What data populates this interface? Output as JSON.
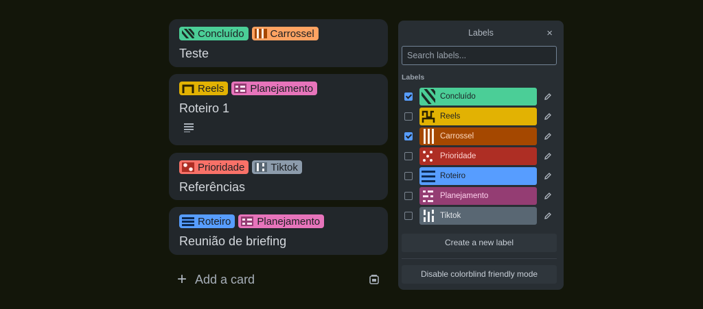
{
  "colors": {
    "background": "#13160a",
    "card": "#22272b",
    "popover": "#282e33",
    "green": "#4bce97",
    "orange": "#fea362",
    "yellow": "#e2b203",
    "red": "#f87168",
    "purple": "#e774bb",
    "gray": "#8c9bab",
    "blue": "#579dff"
  },
  "cards": [
    {
      "title": "Teste",
      "labels": [
        "Concluído",
        "Carrossel"
      ]
    },
    {
      "title": "Roteiro 1",
      "labels": [
        "Reels",
        "Planejamento"
      ],
      "has_description": true
    },
    {
      "title": "Referências",
      "labels": [
        "Prioridade",
        "Tiktok"
      ]
    },
    {
      "title": "Reunião de briefing",
      "labels": [
        "Roteiro",
        "Planejamento"
      ]
    }
  ],
  "add_card": {
    "label": "Add a card"
  },
  "popover": {
    "title": "Labels",
    "close": "×",
    "search_placeholder": "Search labels...",
    "section_label": "Labels",
    "labels": [
      {
        "name": "Concluído",
        "checked": true
      },
      {
        "name": "Reels",
        "checked": false
      },
      {
        "name": "Carrossel",
        "checked": true
      },
      {
        "name": "Prioridade",
        "checked": false
      },
      {
        "name": "Roteiro",
        "checked": false
      },
      {
        "name": "Planejamento",
        "checked": false
      },
      {
        "name": "Tiktok",
        "checked": false
      }
    ],
    "create_label": "Create a new label",
    "colorblind_label": "Disable colorblind friendly mode"
  }
}
